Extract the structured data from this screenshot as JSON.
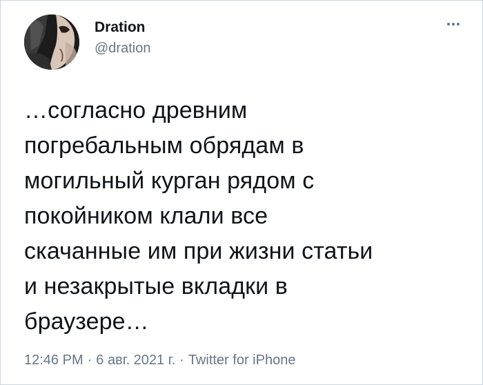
{
  "user": {
    "display_name": "Dration",
    "handle": "@dration"
  },
  "tweet": {
    "text": "…согласно древним\nпогребальным обрядам в\nмогильный курган рядом с\nпокойником клали все\nскачанные им при жизни статьи\nи незакрытые вкладки в\nбраузере…"
  },
  "meta": {
    "time": "12:46 PM",
    "date": "6 авг. 2021 г.",
    "separator": "·",
    "source": "Twitter for iPhone"
  },
  "icons": {
    "more": "more-horizontal-icon",
    "avatar": "avatar-image"
  },
  "colors": {
    "text": "#0f1419",
    "secondary": "#657786",
    "border": "#ccd6dd"
  }
}
